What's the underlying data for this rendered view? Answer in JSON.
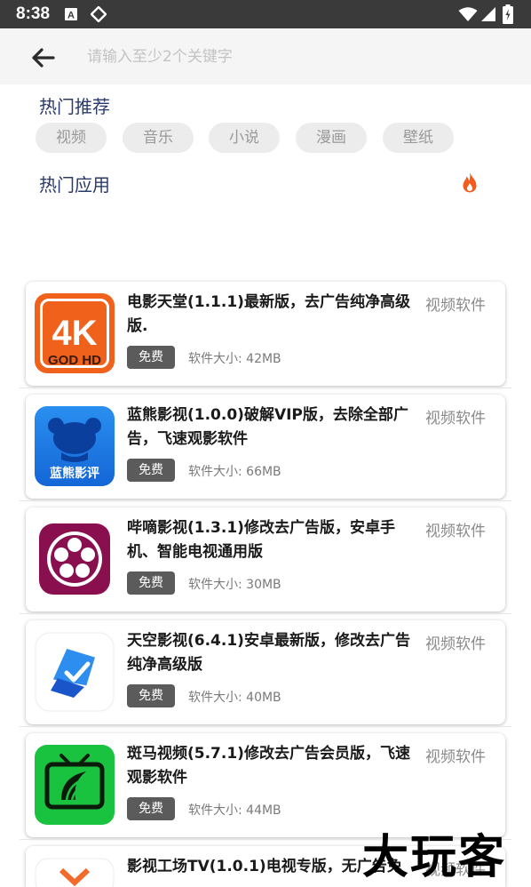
{
  "status_bar": {
    "time": "8:38"
  },
  "search": {
    "placeholder": "请输入至少2个关键字",
    "value": ""
  },
  "hot_recommend": {
    "title": "热门推荐",
    "tags": [
      "视频",
      "音乐",
      "小说",
      "漫画",
      "壁纸"
    ]
  },
  "hot_apps": {
    "title": "热门应用",
    "items": [
      {
        "title": "电影天堂(1.1.1)最新版，去广告纯净高级版.",
        "category": "视频软件",
        "badge": "免费",
        "size": "软件大小: 42MB",
        "icon": "4k-god-hd-icon",
        "icon_text": [
          "4K",
          "GOD HD"
        ]
      },
      {
        "title": "蓝熊影视(1.0.0)破解VIP版，去除全部广告，飞速观影软件",
        "category": "视频软件",
        "badge": "免费",
        "size": "软件大小: 66MB",
        "icon": "blue-bear-icon",
        "icon_text": [
          "蓝熊影评"
        ]
      },
      {
        "title": "哔嘀影视(1.3.1)修改去广告版，安卓手机、智能电视通用版",
        "category": "视频软件",
        "badge": "免费",
        "size": "软件大小: 30MB",
        "icon": "film-reel-icon"
      },
      {
        "title": "天空影视(6.4.1)安卓最新版，修改去广告纯净高级版",
        "category": "视频软件",
        "badge": "免费",
        "size": "软件大小: 40MB",
        "icon": "sky-check-icon"
      },
      {
        "title": "斑马视频(5.7.1)修改去广告会员版，飞速观影软件",
        "category": "视频软件",
        "badge": "免费",
        "size": "软件大小: 44MB",
        "icon": "zebra-tv-icon"
      },
      {
        "title": "影视工场TV(1.0.1)电视专版，无广告免",
        "category": "视频软件",
        "badge": "",
        "size": "",
        "icon": "film-factory-icon"
      }
    ]
  },
  "watermark": "大玩客",
  "colors": {
    "section_title": "#2a3b6b",
    "chip_bg": "#ececec",
    "badge_bg": "#5b5b5b",
    "fire": "#f25a1e"
  }
}
